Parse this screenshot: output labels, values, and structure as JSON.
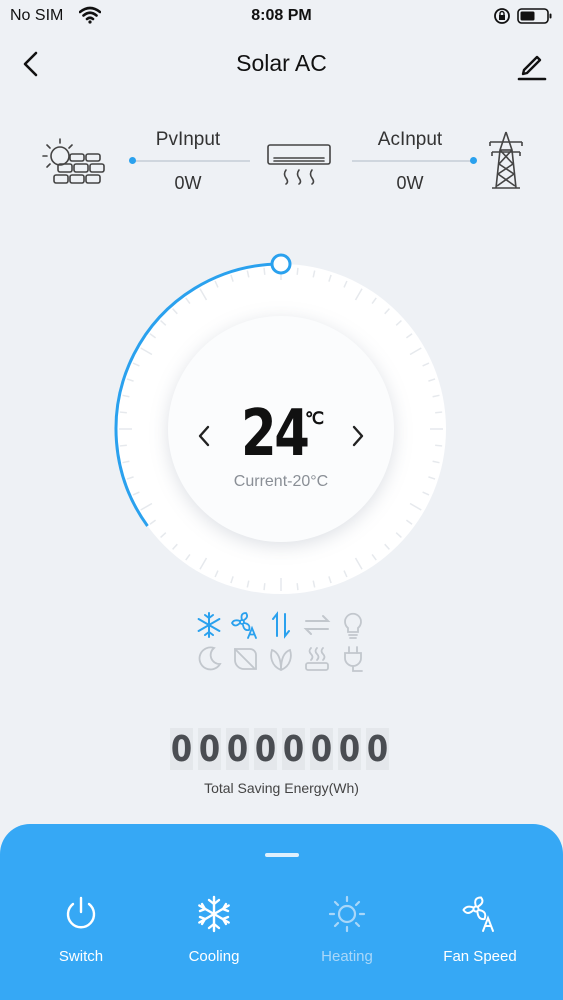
{
  "status_bar": {
    "carrier": "No SIM",
    "time": "8:08 PM"
  },
  "nav": {
    "title": "Solar AC"
  },
  "flow": {
    "pv_label": "PvInput",
    "pv_value": "0W",
    "ac_label": "AcInput",
    "ac_value": "0W"
  },
  "thermostat": {
    "set_temp": "24",
    "unit": "℃",
    "current_text": "Current-20°C",
    "dial_progress_fraction": 0.35,
    "accent_color": "#2aa1ee"
  },
  "modes": {
    "row1": [
      "snowflake-icon",
      "fan-auto-icon",
      "swing-icon",
      "exchange-icon",
      "bulb-icon"
    ],
    "row2": [
      "moon-icon",
      "leaf-icon",
      "eco-leaf-icon",
      "heater-icon",
      "plug-icon"
    ],
    "active": [
      "snowflake-icon",
      "fan-auto-icon",
      "swing-icon"
    ]
  },
  "energy": {
    "digits": [
      "0",
      "0",
      "0",
      "0",
      "0",
      "0",
      "0",
      "0"
    ],
    "label": "Total Saving Energy(Wh)"
  },
  "controls": {
    "switch_label": "Switch",
    "cooling_label": "Cooling",
    "heating_label": "Heating",
    "fan_speed_label": "Fan Speed",
    "panel_color": "#36a8f5"
  }
}
